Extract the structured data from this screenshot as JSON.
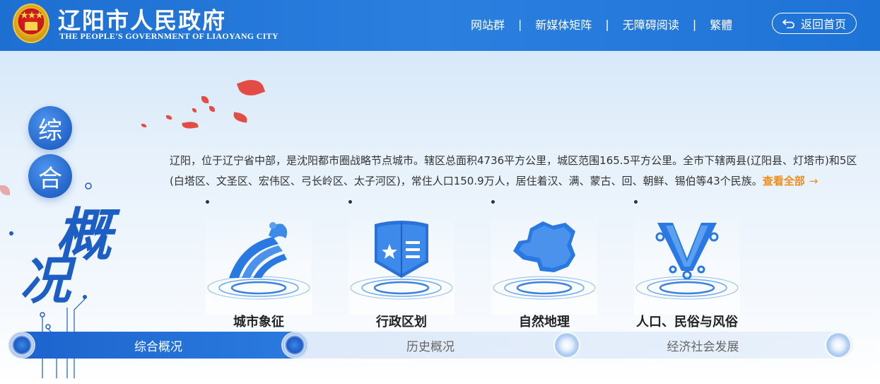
{
  "header": {
    "title": "辽阳市人民政府",
    "subtitle": "THE PEOPLE'S GOVERNMENT OF LIAOYANG CITY",
    "nav": [
      "网站群",
      "新媒体矩阵",
      "无障碍阅读",
      "繁體"
    ],
    "nav_separator": "|",
    "home_button": "返回首页"
  },
  "section_title": {
    "chars": [
      "综",
      "合",
      "概",
      "况"
    ]
  },
  "intro": {
    "text": "辽阳，位于辽宁省中部，是沈阳都市圈战略节点城市。辖区总面积4736平方公里，城区范围165.5平方公里。全市下辖两县(辽阳县、灯塔市)和5区(白塔区、文圣区、宏伟区、弓长岭区、太子河区)，常住人口150.9万人，居住着汉、满、蒙古、回、朝鲜、锡伯等43个民族。",
    "more_link": "查看全部",
    "more_arrow": "→"
  },
  "cards": [
    {
      "label": "城市象征",
      "icon": "city-symbol-icon"
    },
    {
      "label": "行政区划",
      "icon": "admin-division-icon"
    },
    {
      "label": "自然地理",
      "icon": "map-icon"
    },
    {
      "label": "人口、民俗与风俗",
      "icon": "folk-pattern-icon"
    }
  ],
  "tabs": [
    {
      "label": "综合概况",
      "active": true
    },
    {
      "label": "历史概况",
      "active": false
    },
    {
      "label": "经济社会发展",
      "active": false
    }
  ],
  "colors": {
    "header_blue": "#1d6fd1",
    "accent_orange": "#f08c1a",
    "title_blue": "#1d5ec5"
  }
}
